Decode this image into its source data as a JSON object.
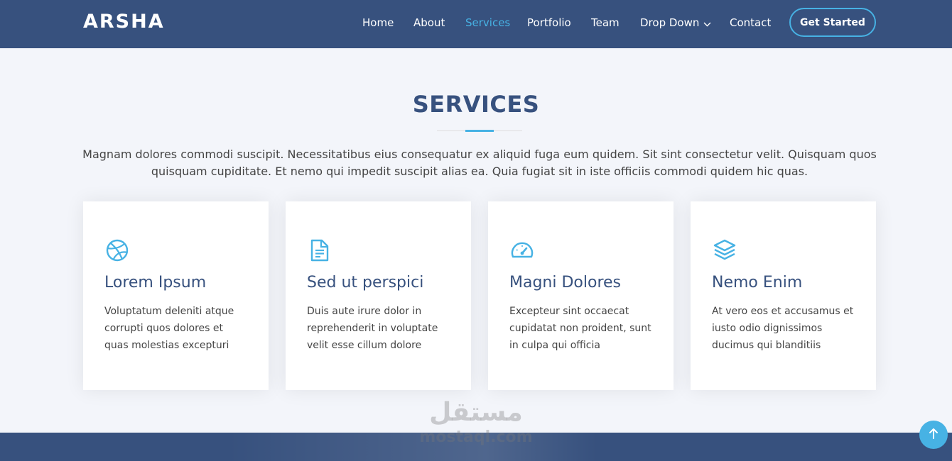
{
  "header": {
    "logo": "ARSHA",
    "nav": [
      {
        "label": "Home"
      },
      {
        "label": "About"
      },
      {
        "label": "Services",
        "active": true
      },
      {
        "label": "Portfolio"
      },
      {
        "label": "Team"
      },
      {
        "label": "Drop Down",
        "dropdown": true
      },
      {
        "label": "Contact"
      }
    ],
    "cta_label": "Get Started"
  },
  "services": {
    "title": "SERVICES",
    "description": "Magnam dolores commodi suscipit. Necessitatibus eius consequatur ex aliquid fuga eum quidem. Sit sint consectetur velit. Quisquam quos quisquam cupiditate. Et nemo qui impedit suscipit alias ea. Quia fugiat sit in iste officiis commodi quidem hic quas.",
    "cards": [
      {
        "icon": "dribbble-icon",
        "title": "Lorem Ipsum",
        "text": "Voluptatum deleniti atque corrupti quos dolores et quas molestias excepturi"
      },
      {
        "icon": "file-text-icon",
        "title": "Sed ut perspici",
        "text": "Duis aute irure dolor in reprehenderit in voluptate velit esse cillum dolore"
      },
      {
        "icon": "speedometer-icon",
        "title": "Magni Dolores",
        "text": "Excepteur sint occaecat cupidatat non proident, sunt in culpa qui officia"
      },
      {
        "icon": "layers-icon",
        "title": "Nemo Enim",
        "text": "At vero eos et accusamus et iusto odio dignissimos ducimus qui blanditiis"
      }
    ]
  },
  "watermark": {
    "arabic": "مستقل",
    "latin": "mostaql.com"
  },
  "colors": {
    "primary": "#37517e",
    "accent": "#47b2e4",
    "background": "#f3f5fa",
    "text": "#444444"
  }
}
